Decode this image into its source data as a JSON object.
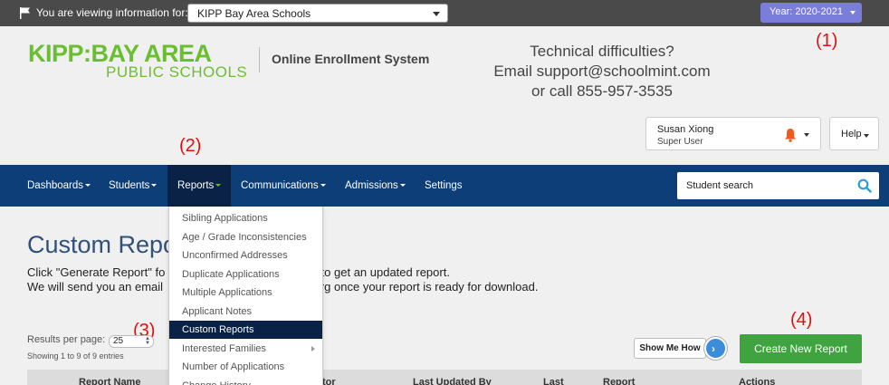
{
  "topbar": {
    "viewing_label": "You are viewing information for:",
    "school_selected": "KIPP Bay Area Schools",
    "year_label": "Year:  2020-2021"
  },
  "header": {
    "logo_line1": "KIPP:BAY AREA",
    "logo_line2": "PUBLIC SCHOOLS",
    "system_title": "Online Enrollment System",
    "tech_line1": "Technical difficulties?",
    "tech_line2": "Email support@schoolmint.com",
    "tech_line3": "or call 855-957-3535"
  },
  "annotations": [
    "(1)",
    "(2)",
    "(3)",
    "(4)"
  ],
  "user": {
    "name": "Susan Xiong",
    "role": "Super User"
  },
  "help_label": "Help",
  "nav": {
    "items": [
      "Dashboards",
      "Students",
      "Reports",
      "Communications",
      "Admissions",
      "Settings"
    ],
    "active": "Reports",
    "search_placeholder": "Student search"
  },
  "reports_menu": {
    "items": [
      "Sibling Applications",
      "Age / Grade Inconsistencies",
      "Unconfirmed Addresses",
      "Duplicate Applications",
      "Multiple Applications",
      "Applicant Notes",
      "Custom Reports",
      "Interested Families",
      "Number of Applications",
      "Change History"
    ],
    "active": "Custom Reports"
  },
  "main": {
    "title_visible": "Custom Repo",
    "desc1_visible": "Click \"Generate Report\" fo",
    "desc1_tail": "rt to get an updated report.",
    "desc2_visible": "We will send you an email",
    "desc2_tail": ".org once your report is ready for download.",
    "results_per_page_label": "Results per page:",
    "results_per_page_value": "25",
    "showing": "Showing 1 to 9 of 9 entries",
    "show_me_how": "Show Me How",
    "create_button": "Create New Report",
    "table_headers": [
      "Report Name",
      "tor",
      "Last Updated By",
      "Last",
      "Report",
      "Actions"
    ]
  },
  "colors": {
    "topbar": "#4a4a4a",
    "year_button": "#7b7ed8",
    "brand_green": "#6abf30",
    "navbar": "#0d3e78",
    "nav_active": "#0a2245",
    "create_button": "#3fa33f",
    "annotation": "#e01010"
  }
}
